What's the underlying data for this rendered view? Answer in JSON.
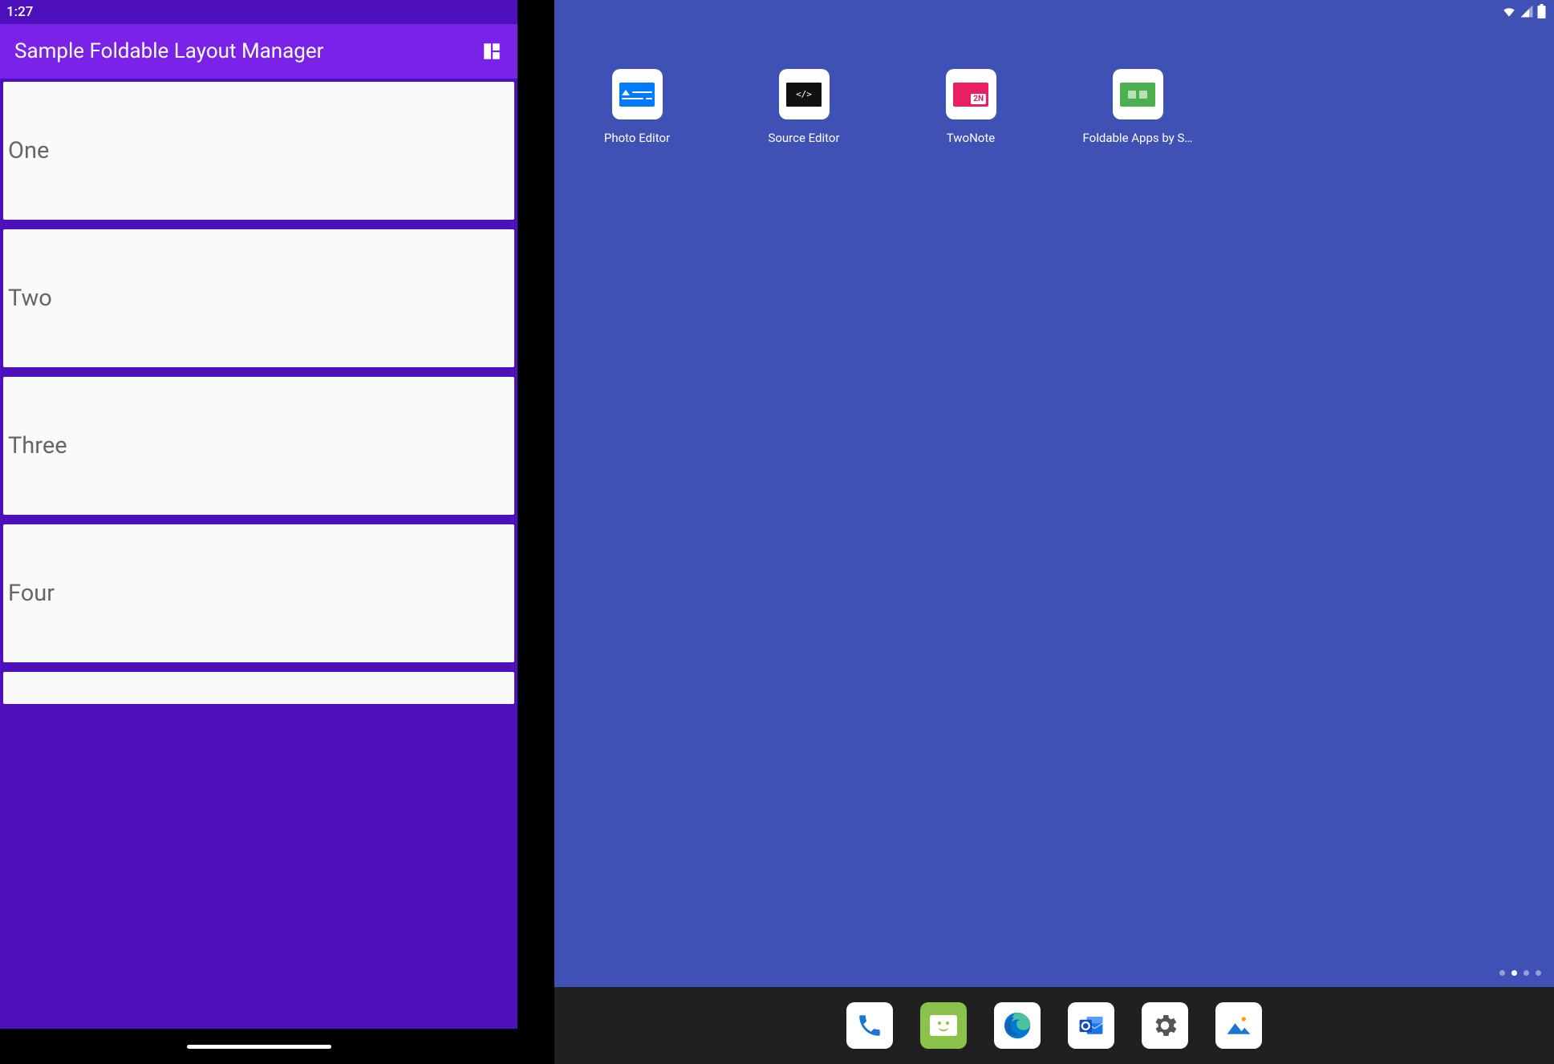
{
  "left": {
    "status_time": "1:27",
    "app_title": "Sample Foldable Layout Manager",
    "items": [
      "One",
      "Two",
      "Three",
      "Four"
    ]
  },
  "right": {
    "apps": [
      {
        "label": "Photo Editor"
      },
      {
        "label": "Source Editor"
      },
      {
        "label": "TwoNote"
      },
      {
        "label": "Foldable Apps by S…"
      }
    ],
    "twonote_badge": "2N",
    "source_code": "</>"
  }
}
